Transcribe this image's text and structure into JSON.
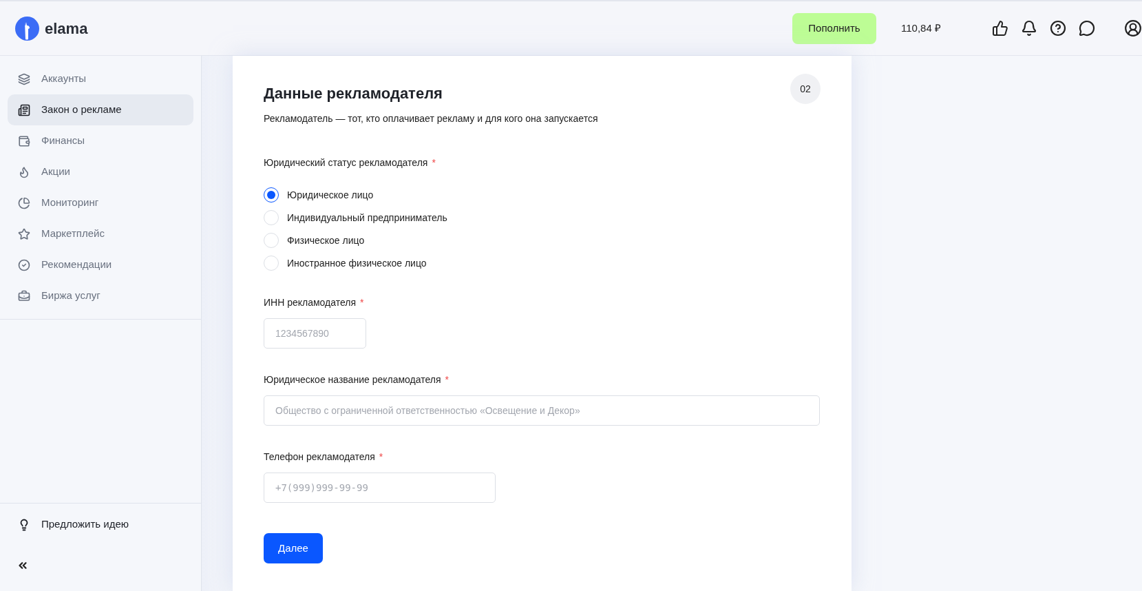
{
  "header": {
    "logo_text": "elama",
    "topup_button": "Пополнить",
    "balance": "110,84 ₽"
  },
  "sidebar": {
    "items": [
      {
        "label": "Аккаунты",
        "selected": false
      },
      {
        "label": "Закон о рекламе",
        "selected": true
      },
      {
        "label": "Финансы",
        "selected": false
      },
      {
        "label": "Акции",
        "selected": false
      },
      {
        "label": "Мониторинг",
        "selected": false
      },
      {
        "label": "Маркетплейс",
        "selected": false
      },
      {
        "label": "Рекомендации",
        "selected": false
      },
      {
        "label": "Биржа услуг",
        "selected": false
      }
    ],
    "idea": "Предложить идею"
  },
  "form": {
    "title": "Данные рекламодателя",
    "step": "02",
    "subtitle": "Рекламодатель — тот, кто оплачивает рекламу и для кого она запускается",
    "status": {
      "label": "Юридический статус рекламодателя",
      "required_mark": "*",
      "options": [
        {
          "label": "Юридическое лицо",
          "selected": true
        },
        {
          "label": "Индивидуальный предприниматель",
          "selected": false
        },
        {
          "label": "Физическое лицо",
          "selected": false
        },
        {
          "label": "Иностранное физическое лицо",
          "selected": false
        }
      ]
    },
    "fields": [
      {
        "label": "ИНН рекламодателя",
        "required_mark": "*",
        "placeholder": "1234567890"
      },
      {
        "label": "Юридическое название рекламодателя",
        "required_mark": "*",
        "placeholder": "Общество с ограниченной ответственностью «Освещение и Декор»"
      },
      {
        "label": "Телефон рекламодателя",
        "required_mark": "*",
        "placeholder": "+7(999)999-99-99"
      }
    ],
    "next_button": "Далее"
  }
}
